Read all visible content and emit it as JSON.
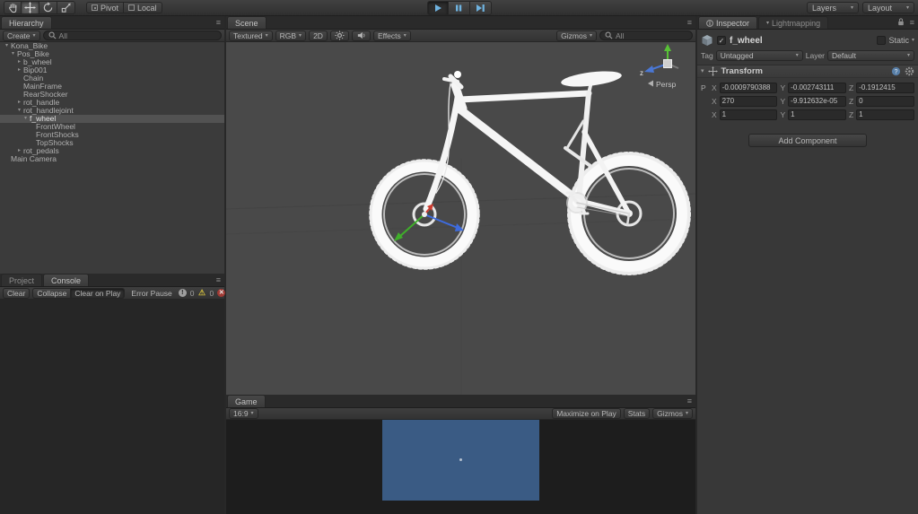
{
  "icons": {
    "caret": "▾",
    "fold_open": "▾",
    "fold_closed": "▸",
    "menu": "≡",
    "check": "✓",
    "warning_sign": "⚠"
  },
  "toolbar": {
    "pivot": "Pivot",
    "local": "Local",
    "layers": "Layers",
    "layout": "Layout"
  },
  "hierarchy": {
    "tab": "Hierarchy",
    "create": "Create",
    "search_text": "All",
    "items": [
      {
        "label": "Kona_Bike"
      },
      {
        "label": "Pos_Bike"
      },
      {
        "label": "b_wheel"
      },
      {
        "label": "Bip001"
      },
      {
        "label": "Chain"
      },
      {
        "label": "MainFrame"
      },
      {
        "label": "RearShocker"
      },
      {
        "label": "rot_handle"
      },
      {
        "label": "rot_handlejoint"
      },
      {
        "label": "f_wheel"
      },
      {
        "label": "FrontWheel"
      },
      {
        "label": "FrontShocks"
      },
      {
        "label": "TopShocks"
      },
      {
        "label": "rot_pedals"
      },
      {
        "label": "Main Camera"
      }
    ]
  },
  "console": {
    "project_tab": "Project",
    "console_tab": "Console",
    "clear": "Clear",
    "collapse": "Collapse",
    "clear_on_play": "Clear on Play",
    "error_pause": "Error Pause",
    "info_count": "0",
    "warning_count": "0",
    "error_count": "0"
  },
  "scene": {
    "tab": "Scene",
    "shading": "Textured",
    "color_mode": "RGB",
    "mode_2d": "2D",
    "effects": "Effects",
    "gizmos": "Gizmos",
    "search_text": "All",
    "axis_z_label": "z",
    "persp_label": "Persp"
  },
  "game": {
    "tab": "Game",
    "aspect": "16:9",
    "maximize": "Maximize on Play",
    "stats": "Stats",
    "gizmos": "Gizmos"
  },
  "inspector": {
    "tab": "Inspector",
    "lightmapping_tab": "Lightmapping",
    "object_name": "f_wheel",
    "static_label": "Static",
    "tag_label": "Tag",
    "tag_value": "Untagged",
    "layer_label": "Layer",
    "layer_value": "Default",
    "transform": {
      "title": "Transform",
      "row_label_position": "P",
      "row_label_rotation": "",
      "row_label_scale": "",
      "axis_x": "X",
      "axis_y": "Y",
      "axis_z": "Z",
      "position": {
        "x": "-0.0009790388",
        "y": "-0.002743111",
        "z": "-0.1912415"
      },
      "rotation": {
        "x": "270",
        "y": "-9.912632e-05",
        "z": "0"
      },
      "scale": {
        "x": "1",
        "y": "1",
        "z": "1"
      }
    },
    "add_component": "Add Component"
  }
}
